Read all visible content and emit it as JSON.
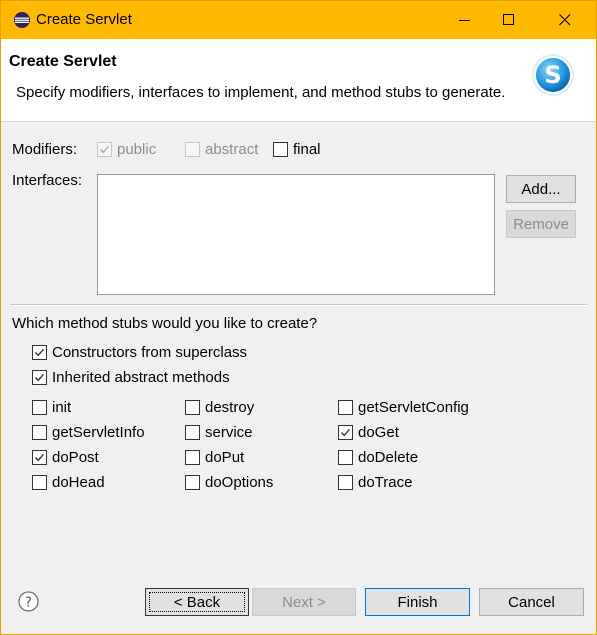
{
  "window": {
    "title": "Create Servlet",
    "accent_color": "#ffb900"
  },
  "header": {
    "title": "Create Servlet",
    "description": "Specify modifiers, interfaces to implement, and method stubs to generate.",
    "logo_letter": "S"
  },
  "modifiers": {
    "label": "Modifiers:",
    "public": {
      "label": "public",
      "checked": true,
      "enabled": false
    },
    "abstract": {
      "label": "abstract",
      "checked": false,
      "enabled": false
    },
    "final": {
      "label": "final",
      "checked": false,
      "enabled": true
    }
  },
  "interfaces": {
    "label": "Interfaces:",
    "add_label": "Add...",
    "remove_label": "Remove",
    "items": []
  },
  "stubs": {
    "question": "Which method stubs would you like to create?",
    "constructors": {
      "label": "Constructors from superclass",
      "checked": true
    },
    "inherited": {
      "label": "Inherited abstract methods",
      "checked": true
    },
    "methods": [
      {
        "label": "init",
        "checked": false
      },
      {
        "label": "destroy",
        "checked": false
      },
      {
        "label": "getServletConfig",
        "checked": false
      },
      {
        "label": "getServletInfo",
        "checked": false
      },
      {
        "label": "service",
        "checked": false
      },
      {
        "label": "doGet",
        "checked": true
      },
      {
        "label": "doPost",
        "checked": true
      },
      {
        "label": "doPut",
        "checked": false
      },
      {
        "label": "doDelete",
        "checked": false
      },
      {
        "label": "doHead",
        "checked": false
      },
      {
        "label": "doOptions",
        "checked": false
      },
      {
        "label": "doTrace",
        "checked": false
      }
    ]
  },
  "footer": {
    "back_label": "< Back",
    "next_label": "Next >",
    "finish_label": "Finish",
    "cancel_label": "Cancel"
  },
  "icons": {
    "app": "eclipse-icon",
    "minimize": "minimize-icon",
    "maximize": "maximize-icon",
    "close": "close-icon",
    "help": "help-icon",
    "check": "check-icon"
  }
}
